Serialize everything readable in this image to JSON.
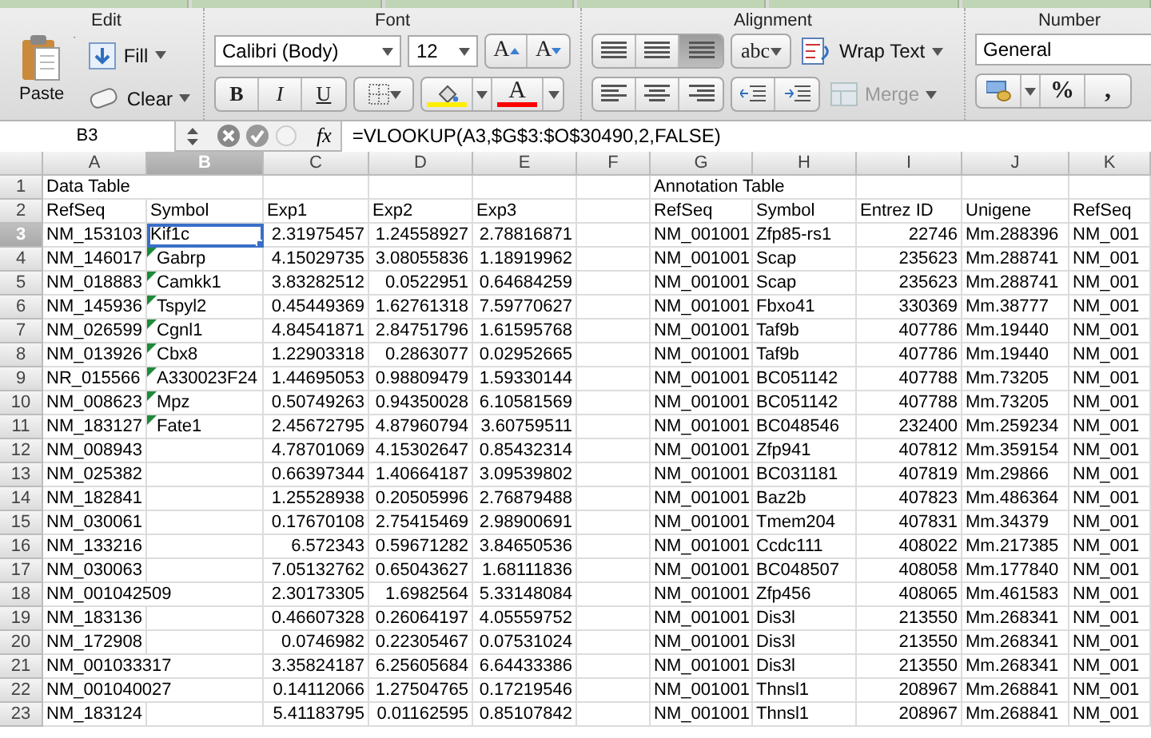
{
  "ribbon": {
    "edit": {
      "title": "Edit",
      "paste_label": "Paste",
      "fill_label": "Fill",
      "clear_label": "Clear"
    },
    "font": {
      "title": "Font",
      "font_name": "Calibri (Body)",
      "font_size": "12",
      "grow": "A",
      "shrink": "A",
      "bold": "B",
      "italic": "I",
      "underline": "U",
      "font_color": "A"
    },
    "alignment": {
      "title": "Alignment",
      "vertical_buttons": [
        {
          "selected": false
        },
        {
          "selected": false
        },
        {
          "selected": true
        }
      ],
      "orientation": "abc",
      "wrap_text": "Wrap Text",
      "merge": "Merge",
      "merge_disabled": true
    },
    "number": {
      "title": "Number",
      "format": "General",
      "percent": "%",
      "comma": ","
    }
  },
  "formula_bar": {
    "cell_ref": "B3",
    "fx": "fx",
    "formula": "=VLOOKUP(A3,$G$3:$O$30490,2,FALSE)"
  },
  "sheet": {
    "columns": [
      {
        "label": "A",
        "selected": false
      },
      {
        "label": "B",
        "selected": true
      },
      {
        "label": "C",
        "selected": false
      },
      {
        "label": "D",
        "selected": false
      },
      {
        "label": "E",
        "selected": false
      },
      {
        "label": "F",
        "selected": false
      },
      {
        "label": "G",
        "selected": false
      },
      {
        "label": "H",
        "selected": false
      },
      {
        "label": "I",
        "selected": false
      },
      {
        "label": "J",
        "selected": false
      },
      {
        "label": "K",
        "selected": false
      }
    ],
    "rows": [
      {
        "number": "1",
        "selected": false,
        "flagged": false,
        "cells": [
          "Data Table",
          null,
          null,
          null,
          null,
          null,
          "Annotation Table",
          null,
          null,
          null,
          null
        ]
      },
      {
        "number": "2",
        "selected": false,
        "flagged": false,
        "cells": [
          "RefSeq",
          "Symbol",
          "Exp1",
          "Exp2",
          "Exp3",
          null,
          "RefSeq",
          "Symbol",
          "Entrez ID",
          "Unigene",
          "RefSeq"
        ]
      },
      {
        "number": "3",
        "selected": true,
        "flagged": false,
        "cells": [
          "NM_153103",
          "Kif1c",
          "2.31975457",
          "1.24558927",
          "2.78816871",
          null,
          "NM_001001",
          "Zfp85-rs1",
          "22746",
          "Mm.288396",
          "NM_001"
        ]
      },
      {
        "number": "4",
        "selected": false,
        "flagged": true,
        "cells": [
          "NM_146017",
          "Gabrp",
          "4.15029735",
          "3.08055836",
          "1.18919962",
          null,
          "NM_001001",
          "Scap",
          "235623",
          "Mm.288741",
          "NM_001"
        ]
      },
      {
        "number": "5",
        "selected": false,
        "flagged": true,
        "cells": [
          "NM_018883",
          "Camkk1",
          "3.83282512",
          "0.0522951",
          "0.64684259",
          null,
          "NM_001001",
          "Scap",
          "235623",
          "Mm.288741",
          "NM_001"
        ]
      },
      {
        "number": "6",
        "selected": false,
        "flagged": true,
        "cells": [
          "NM_145936",
          "Tspyl2",
          "0.45449369",
          "1.62761318",
          "7.59770627",
          null,
          "NM_001001",
          "Fbxo41",
          "330369",
          "Mm.38777",
          "NM_001"
        ]
      },
      {
        "number": "7",
        "selected": false,
        "flagged": true,
        "cells": [
          "NM_026599",
          "Cgnl1",
          "4.84541871",
          "2.84751796",
          "1.61595768",
          null,
          "NM_001001",
          "Taf9b",
          "407786",
          "Mm.19440",
          "NM_001"
        ]
      },
      {
        "number": "8",
        "selected": false,
        "flagged": true,
        "cells": [
          "NM_013926",
          "Cbx8",
          "1.22903318",
          "0.2863077",
          "0.02952665",
          null,
          "NM_001001",
          "Taf9b",
          "407786",
          "Mm.19440",
          "NM_001"
        ]
      },
      {
        "number": "9",
        "selected": false,
        "flagged": true,
        "cells": [
          "NR_015566",
          "A330023F24",
          "1.44695053",
          "0.98809479",
          "1.59330144",
          null,
          "NM_001001",
          "BC051142",
          "407788",
          "Mm.73205",
          "NM_001"
        ]
      },
      {
        "number": "10",
        "selected": false,
        "flagged": true,
        "cells": [
          "NM_008623",
          "Mpz",
          "0.50749263",
          "0.94350028",
          "6.10581569",
          null,
          "NM_001001",
          "BC051142",
          "407788",
          "Mm.73205",
          "NM_001"
        ]
      },
      {
        "number": "11",
        "selected": false,
        "flagged": true,
        "cells": [
          "NM_183127",
          "Fate1",
          "2.45672795",
          "4.87960794",
          "3.60759511",
          null,
          "NM_001001",
          "BC048546",
          "232400",
          "Mm.259234",
          "NM_001"
        ]
      },
      {
        "number": "12",
        "selected": false,
        "flagged": false,
        "cells": [
          "NM_008943",
          null,
          "4.78701069",
          "4.15302647",
          "0.85432314",
          null,
          "NM_001001",
          "Zfp941",
          "407812",
          "Mm.359154",
          "NM_001"
        ]
      },
      {
        "number": "13",
        "selected": false,
        "flagged": false,
        "cells": [
          "NM_025382",
          null,
          "0.66397344",
          "1.40664187",
          "3.09539802",
          null,
          "NM_001001",
          "BC031181",
          "407819",
          "Mm.29866",
          "NM_001"
        ]
      },
      {
        "number": "14",
        "selected": false,
        "flagged": false,
        "cells": [
          "NM_182841",
          null,
          "1.25528938",
          "0.20505996",
          "2.76879488",
          null,
          "NM_001001",
          "Baz2b",
          "407823",
          "Mm.486364",
          "NM_001"
        ]
      },
      {
        "number": "15",
        "selected": false,
        "flagged": false,
        "cells": [
          "NM_030061",
          null,
          "0.17670108",
          "2.75415469",
          "2.98900691",
          null,
          "NM_001001",
          "Tmem204",
          "407831",
          "Mm.34379",
          "NM_001"
        ]
      },
      {
        "number": "16",
        "selected": false,
        "flagged": false,
        "cells": [
          "NM_133216",
          null,
          "6.572343",
          "0.59671282",
          "3.84650536",
          null,
          "NM_001001",
          "Ccdc111",
          "408022",
          "Mm.217385",
          "NM_001"
        ]
      },
      {
        "number": "17",
        "selected": false,
        "flagged": false,
        "cells": [
          "NM_030063",
          null,
          "7.05132762",
          "0.65043627",
          "1.68111836",
          null,
          "NM_001001",
          "BC048507",
          "408058",
          "Mm.177840",
          "NM_001"
        ]
      },
      {
        "number": "18",
        "selected": false,
        "flagged": false,
        "cells": [
          "NM_001042509",
          null,
          "2.30173305",
          "1.6982564",
          "5.33148084",
          null,
          "NM_001001",
          "Zfp456",
          "408065",
          "Mm.461583",
          "NM_001"
        ]
      },
      {
        "number": "19",
        "selected": false,
        "flagged": false,
        "cells": [
          "NM_183136",
          null,
          "0.46607328",
          "0.26064197",
          "4.05559752",
          null,
          "NM_001001",
          "Dis3l",
          "213550",
          "Mm.268341",
          "NM_001"
        ]
      },
      {
        "number": "20",
        "selected": false,
        "flagged": false,
        "cells": [
          "NM_172908",
          null,
          "0.0746982",
          "0.22305467",
          "0.07531024",
          null,
          "NM_001001",
          "Dis3l",
          "213550",
          "Mm.268341",
          "NM_001"
        ]
      },
      {
        "number": "21",
        "selected": false,
        "flagged": false,
        "cells": [
          "NM_001033317",
          null,
          "3.35824187",
          "6.25605684",
          "6.64433386",
          null,
          "NM_001001",
          "Dis3l",
          "213550",
          "Mm.268341",
          "NM_001"
        ]
      },
      {
        "number": "22",
        "selected": false,
        "flagged": false,
        "cells": [
          "NM_001040027",
          null,
          "0.14112066",
          "1.27504765",
          "0.17219546",
          null,
          "NM_001001",
          "Thnsl1",
          "208967",
          "Mm.268841",
          "NM_001"
        ]
      },
      {
        "number": "23",
        "selected": false,
        "flagged": false,
        "cells": [
          "NM_183124",
          null,
          "5.41183795",
          "0.01162595",
          "0.85107842",
          null,
          "NM_001001",
          "Thnsl1",
          "208967",
          "Mm.268841",
          "NM_001"
        ]
      }
    ]
  }
}
